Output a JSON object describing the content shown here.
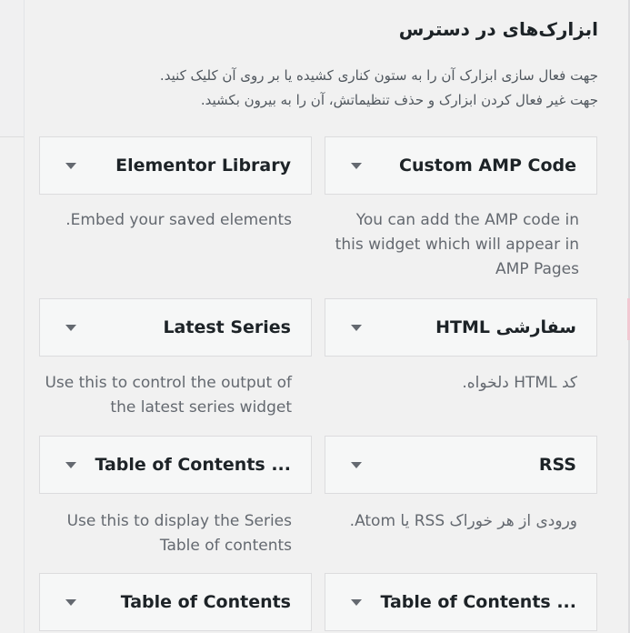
{
  "available_widgets": {
    "title": "ابزارک‌های در دسترس",
    "description_line1": "جهت فعال سازی ابزارک آن را به ستون کناری کشیده یا بر روی آن کلیک کنید.",
    "description_line2": "جهت غیر فعال کردن ابزارک و حذف تنظیماتش، آن را به بیرون بکشید.",
    "widgets": [
      {
        "name": "Custom AMP Code",
        "description": "You can add the AMP code in this widget which will appear in AMP Pages"
      },
      {
        "name": "Elementor Library",
        "description": ".Embed your saved elements"
      },
      {
        "name": "HTML سفارشی",
        "description": "کد HTML دلخواه."
      },
      {
        "name": "Latest Series",
        "description": "Use this to control the output of the latest series widget"
      },
      {
        "name": "RSS",
        "description": "ورودی از هر خوراک RSS یا Atom."
      },
      {
        "name": "Table of Contents ...",
        "description": "Use this to display the Series Table of contents"
      },
      {
        "name": "Table of Contents ...",
        "description": ""
      },
      {
        "name": "Table of Contents",
        "description": ""
      }
    ]
  },
  "icons": {
    "dropdown": "caret-down-icon"
  },
  "colors": {
    "background": "#f1f1f1",
    "widget_bg": "#f6f7f7",
    "border": "#dcdcde",
    "title": "#1d2327",
    "desc": "#646970"
  }
}
